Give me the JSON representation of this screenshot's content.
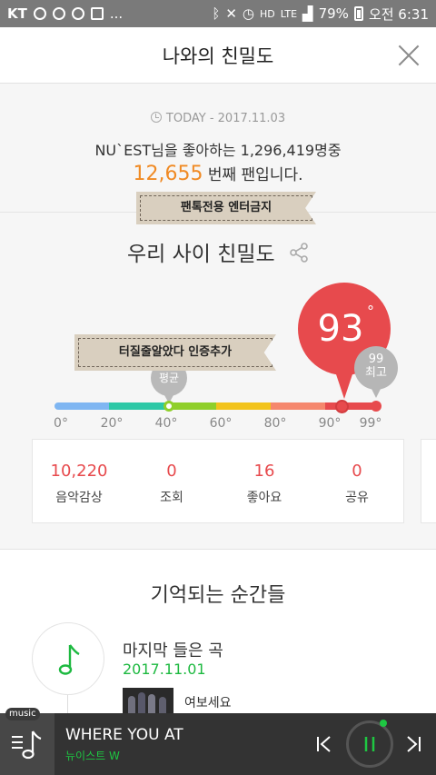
{
  "status_bar": {
    "carrier": "KT",
    "more": "...",
    "network": "LTE",
    "battery": "79%",
    "time": "오전 6:31",
    "icons": [
      "kakaotalk-icon",
      "music-icon",
      "youtube-icon",
      "gallery-icon",
      "bluetooth-icon",
      "mute-icon",
      "alarm-icon",
      "hd-icon",
      "signal-icon",
      "battery-icon"
    ]
  },
  "header": {
    "title": "나와의 친밀도",
    "close_icon": "close-icon"
  },
  "fan": {
    "today_label": "TODAY",
    "today_date": "- 2017.11.03",
    "line1": "NU`EST님을 좋아하는 1,296,419명중",
    "rank": "12,655",
    "rank_suffix": "번째 팬입니다.",
    "ribbon": "팬톡전용 엔터금지"
  },
  "intimacy": {
    "title": "우리 사이 친밀도",
    "my_value": "93",
    "my_degree": "°",
    "max_value": "99",
    "max_label": "최고",
    "avg_label": "평균",
    "ribbon": "터질줄알았다 인증추가",
    "ticks": [
      "0°",
      "20°",
      "40°",
      "60°",
      "80°",
      "90°",
      "99°"
    ],
    "segment_colors": [
      "#7fb6f2",
      "#2dc8a6",
      "#8fcf2a",
      "#f2c31c",
      "#f5876d",
      "#e74a4d"
    ]
  },
  "stats": [
    {
      "value": "10,220",
      "label": "음악감상"
    },
    {
      "value": "0",
      "label": "조회"
    },
    {
      "value": "16",
      "label": "좋아요"
    },
    {
      "value": "0",
      "label": "공유"
    }
  ],
  "moments": {
    "title": "기억되는 순간들",
    "last_song_title": "마지막 들은 곡",
    "last_song_date": "2017.11.01",
    "song_name": "여보세요"
  },
  "player": {
    "tag": "music",
    "title": "WHERE YOU AT",
    "artist": "뉴이스트 W",
    "accent": "#1ec742"
  }
}
